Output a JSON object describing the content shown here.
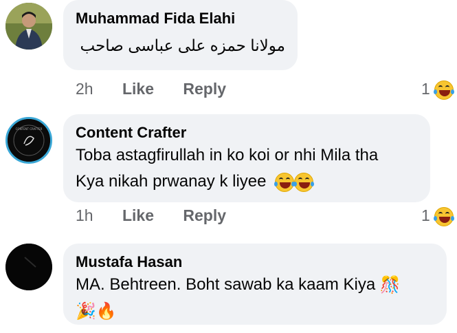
{
  "comments": [
    {
      "author": "Muhammad Fida Elahi",
      "text": "مولانا حمزه على عباسى صاحب",
      "time": "2h",
      "like": "Like",
      "reply": "Reply",
      "reactions": "1",
      "reaction_icon": "laugh-cry-emoji"
    },
    {
      "author": "Content Crafter",
      "text_line1": "Toba astagfirullah in ko koi or nhi Mila tha",
      "text_line2": "Kya nikah prwanay k liyee",
      "time": "1h",
      "like": "Like",
      "reply": "Reply",
      "reactions": "1",
      "reaction_icon": "laugh-cry-emoji",
      "avatar_text": "CONTENT CRAFTER"
    },
    {
      "author": "Mustafa Hasan",
      "text_line1": "MA. Behtreen. Boht sawab ka kaam Kiya",
      "emoji1": "🎊",
      "emoji2": "🎉",
      "emoji3": "🔥"
    }
  ],
  "colors": {
    "bubble": "#f0f2f5",
    "meta": "#65676b",
    "text": "#050505"
  }
}
